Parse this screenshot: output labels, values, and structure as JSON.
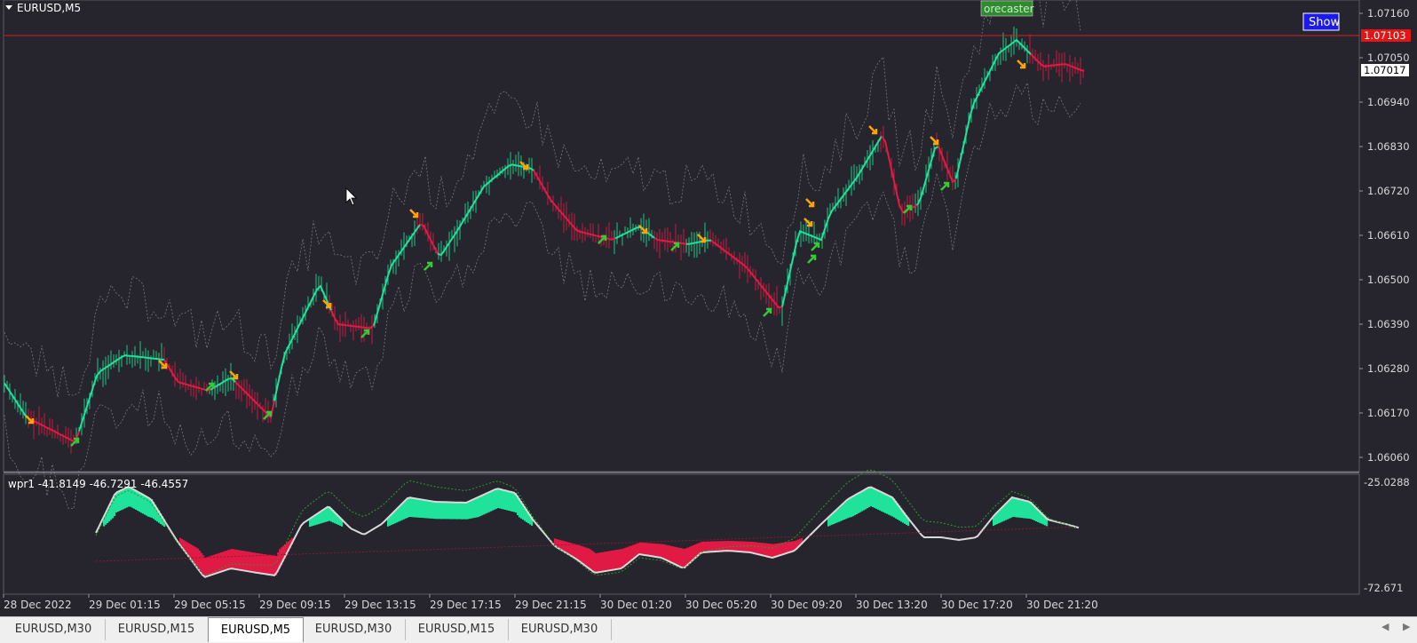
{
  "symbol_title": "EURUSD,M5",
  "show_button": "Show",
  "forecaster_label": "orecaster",
  "price_axis": [
    "1.07160",
    "1.07050",
    "1.06940",
    "1.06830",
    "1.06720",
    "1.06610",
    "1.06500",
    "1.06390",
    "1.06280",
    "1.06170",
    "1.06060"
  ],
  "price_line_marker": "1.07103",
  "current_price_marker": "1.07017",
  "indicator": {
    "label": "wpr1 -41.8149 -46.7291 -46.4557",
    "axis_top": "-25.0288",
    "axis_bottom": "-72.671"
  },
  "time_axis": [
    "28 Dec 2022",
    "29 Dec 01:15",
    "29 Dec 05:15",
    "29 Dec 09:15",
    "29 Dec 13:15",
    "29 Dec 17:15",
    "29 Dec 21:15",
    "30 Dec 01:20",
    "30 Dec 05:20",
    "30 Dec 09:20",
    "30 Dec 13:20",
    "30 Dec 17:20",
    "30 Dec 21:20"
  ],
  "tabs": [
    {
      "label": "EURUSD,M30",
      "active": false
    },
    {
      "label": "EURUSD,M15",
      "active": false
    },
    {
      "label": "EURUSD,M5",
      "active": true
    },
    {
      "label": "EURUSD,M30",
      "active": false
    },
    {
      "label": "EURUSD,M15",
      "active": false
    },
    {
      "label": "EURUSD,M30",
      "active": false
    }
  ],
  "colors": {
    "background": "#26242c",
    "bull": "#1fe39a",
    "bear": "#e01a45",
    "arrow_up": "#37c837",
    "arrow_down": "#ffa500",
    "price_line": "#d61f1f",
    "show_button": "#1a1aee"
  }
}
